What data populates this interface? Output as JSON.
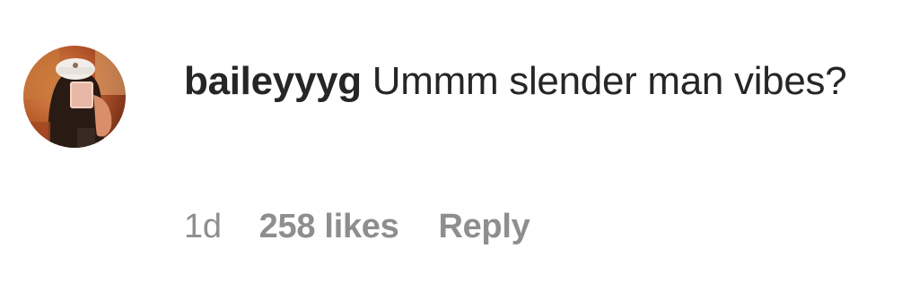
{
  "comment": {
    "username": "baileyyyg",
    "text": "Ummm slender man vibes?",
    "timestamp": "1d",
    "likes": "258 likes",
    "reply_label": "Reply"
  },
  "colors": {
    "primary_text": "#262626",
    "secondary_text": "#8e8e8e",
    "background": "#ffffff"
  }
}
